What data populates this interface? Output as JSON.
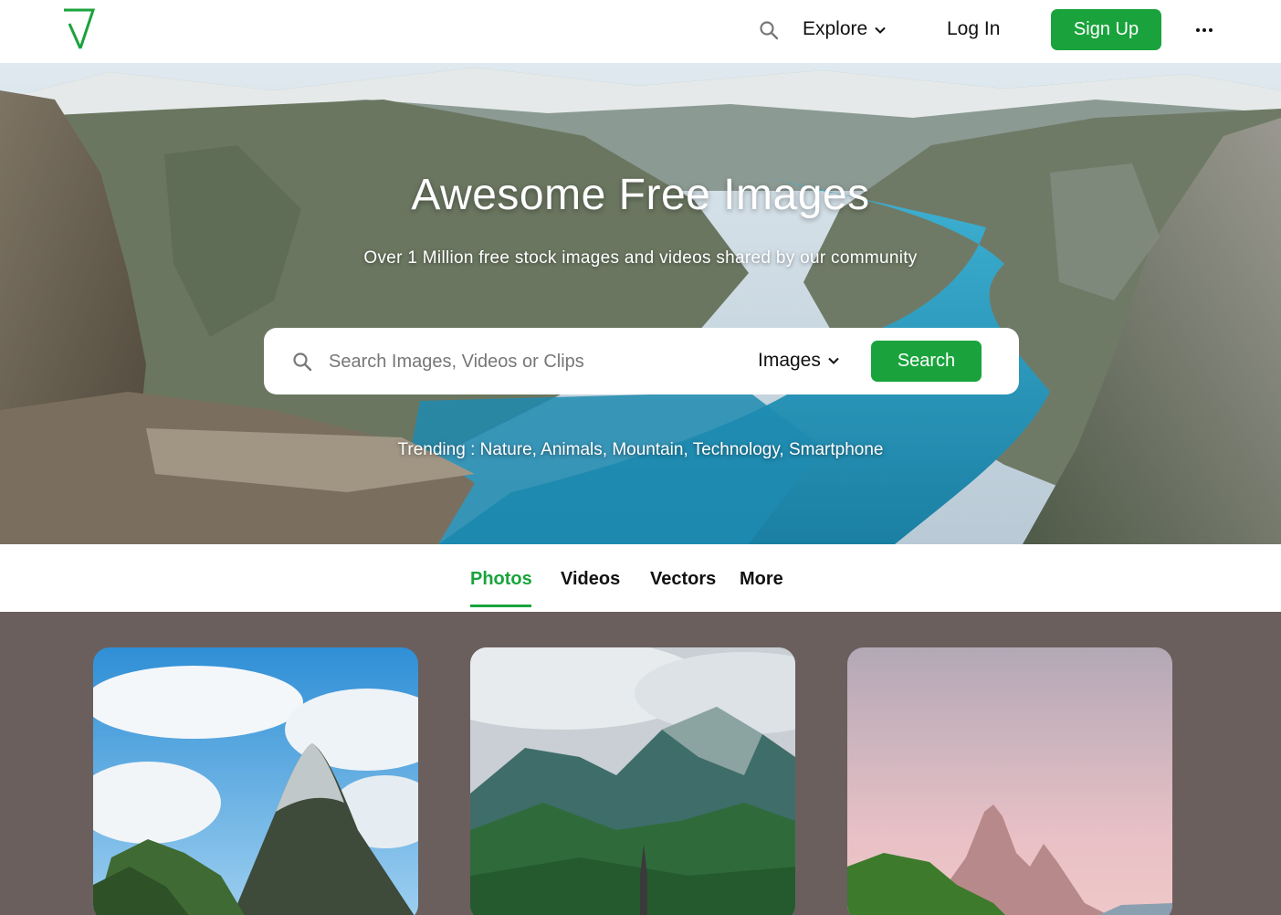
{
  "header": {
    "logo_icon": "v-check-logo",
    "search_icon": "search-icon",
    "explore_label": "Explore",
    "login_label": "Log In",
    "signup_label": "Sign Up",
    "more_icon": "more-horizontal-icon"
  },
  "hero": {
    "title": "Awesome Free Images",
    "subtitle": "Over 1 Million free stock images and videos shared by our community",
    "search": {
      "placeholder": "Search Images, Videos or Clips",
      "value": "",
      "type_selected": "Images",
      "button_label": "Search"
    },
    "trending": {
      "prefix": "Trending : ",
      "items": [
        "Nature",
        "Animals",
        "Mountain",
        "Technology",
        "Smartphone"
      ]
    }
  },
  "tabs": {
    "items": [
      {
        "label": "Photos",
        "active": true
      },
      {
        "label": "Videos",
        "active": false
      },
      {
        "label": "Vectors",
        "active": false
      },
      {
        "label": "More",
        "active": false
      }
    ]
  },
  "gallery": {
    "items": [
      {
        "subject": "cloudy-mountain-peak"
      },
      {
        "subject": "alpine-village-church"
      },
      {
        "subject": "pink-sky-twin-peaks"
      }
    ]
  },
  "colors": {
    "accent": "#1aa33c",
    "gallery_background": "#6b5f5e",
    "text": "#111111"
  }
}
